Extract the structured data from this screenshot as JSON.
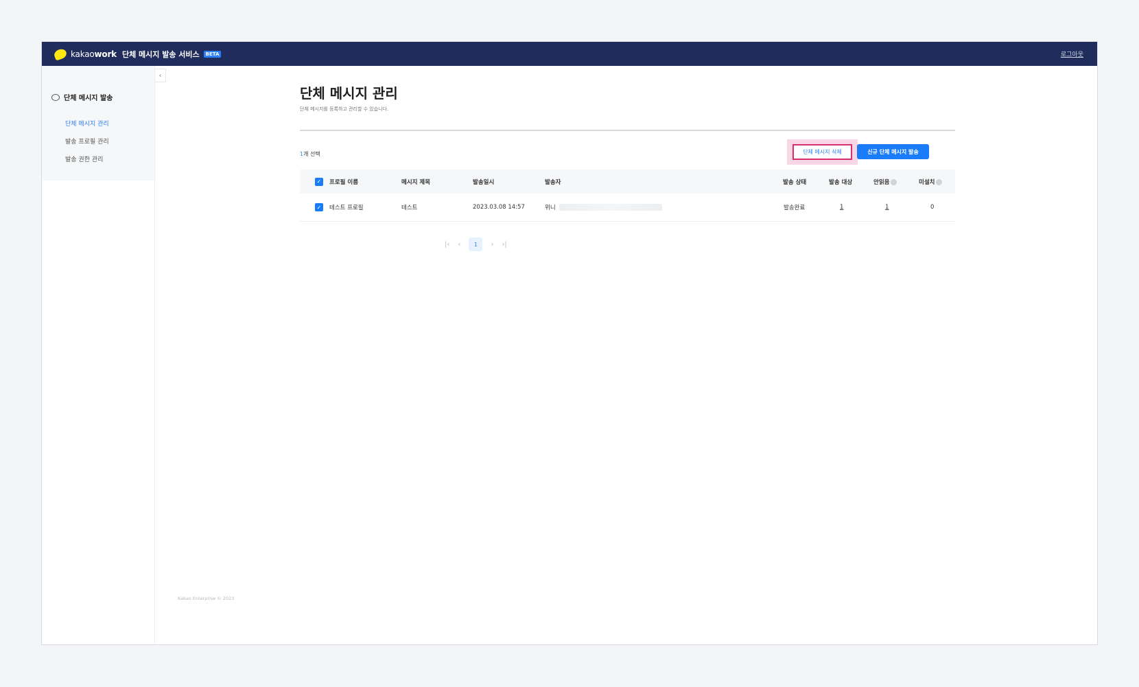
{
  "header": {
    "logo_kakao": "kakao",
    "logo_work": "work",
    "service_title": "단체 메시지 발송 서비스",
    "beta_badge": "BETA",
    "logout_label": "로그아웃"
  },
  "sidebar": {
    "collapse_icon": "chevron-left-icon",
    "section_title": "단체 메시지 발송",
    "items": [
      {
        "label": "단체 메시지 관리",
        "active": true
      },
      {
        "label": "발송 프로필 관리",
        "active": false
      },
      {
        "label": "발송 권한 관리",
        "active": false
      }
    ]
  },
  "main": {
    "title": "단체 메시지 관리",
    "description": "단체 메시지를 등록하고 관리할 수 있습니다.",
    "selected_num": "1",
    "selected_suffix": "개 선택",
    "delete_button": "단체 메시지 삭제",
    "new_button": "신규 단체 메시지 발송",
    "table": {
      "headers": [
        "프로필 이름",
        "메시지 제목",
        "발송일시",
        "발송자",
        "발송 상태",
        "발송 대상",
        "안읽음",
        "미설치"
      ],
      "rows": [
        {
          "profile": "테스트 프로필",
          "title": "테스트",
          "sent_at": "2023.03.08 14:57",
          "sender": "위니",
          "status": "발송완료",
          "targets": "1",
          "unread": "1",
          "not_installed": "0"
        }
      ]
    },
    "pagination": {
      "current": "1"
    },
    "footer": "Kakao Enterprise © 2023"
  },
  "colors": {
    "topbar": "#1f2c5c",
    "accent": "#1a7cf9",
    "highlight": "#d92e6c"
  }
}
